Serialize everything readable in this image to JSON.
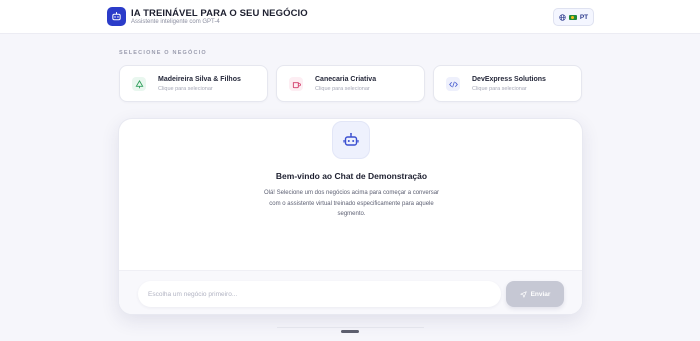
{
  "header": {
    "title": "IA TREINÁVEL PARA O SEU NEGÓCIO",
    "subtitle": "Assistente inteligente com GPT-4",
    "language": "PT",
    "logo_icon": "robot-icon",
    "brand_color": "#2b3cc9"
  },
  "business_section": {
    "label": "SELECIONE O NEGÓCIO",
    "businesses": [
      {
        "name": "Madeireira Silva & Filhos",
        "hint": "Clique para selecionar",
        "icon": "tree-icon",
        "color": "#2e9d5a"
      },
      {
        "name": "Canecaria Criativa",
        "hint": "Clique para selecionar",
        "icon": "mug-icon",
        "color": "#d23c6a"
      },
      {
        "name": "DevExpress Solutions",
        "hint": "Clique para selecionar",
        "icon": "code-icon",
        "color": "#4a5fd1"
      }
    ]
  },
  "chat": {
    "bot_icon": "robot-icon",
    "welcome_title": "Bem-vindo ao Chat de Demonstração",
    "welcome_text": "Olá! Selecione um dos negócios acima para começar a conversar com o assistente virtual treinado especificamente para aquele segmento.",
    "input_placeholder": "Escolha um negócio primeiro...",
    "send_label": "Enviar",
    "send_icon": "send-icon"
  }
}
